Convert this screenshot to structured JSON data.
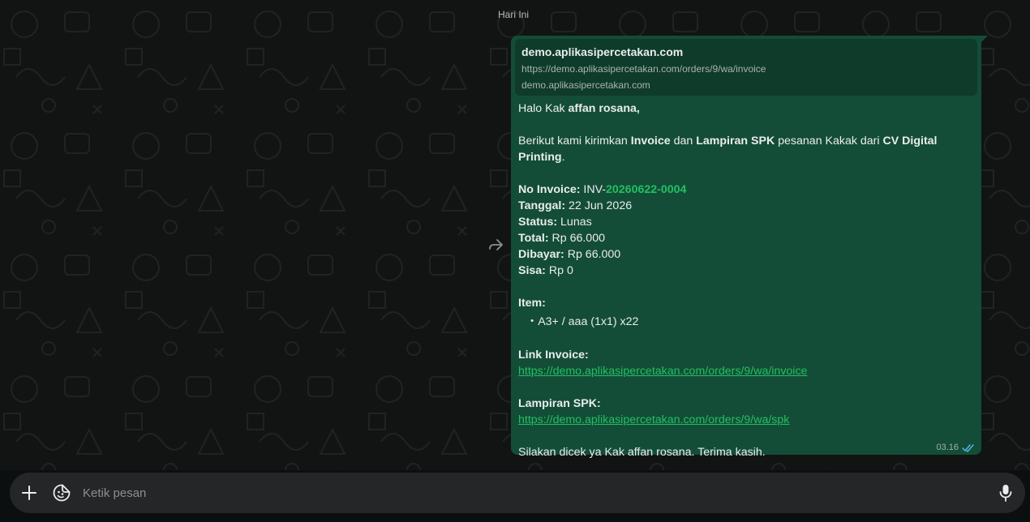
{
  "date_chip": "Hari Ini",
  "message": {
    "link_preview": {
      "title": "demo.aplikasipercetakan.com",
      "url": "https://demo.aplikasipercetakan.com/orders/9/wa/invoice",
      "domain": "demo.aplikasipercetakan.com"
    },
    "greeting_prefix": "Halo Kak ",
    "customer_name": "affan rosana",
    "greeting_suffix": ",",
    "intro": {
      "p1": "Berikut kami kirimkan ",
      "invoice": "Invoice",
      "p2": " dan ",
      "spk": "Lampiran SPK",
      "p3": " pesanan Kakak dari ",
      "company": "CV Digital Printing",
      "p4": "."
    },
    "details": {
      "no_invoice_label": "No Invoice:",
      "no_invoice_prefix": " INV-",
      "no_invoice_number": "20260622-0004",
      "tanggal_label": "Tanggal:",
      "tanggal_value": " 22 Jun 2026",
      "status_label": "Status:",
      "status_value": " Lunas",
      "total_label": "Total:",
      "total_value": " Rp 66.000",
      "dibayar_label": "Dibayar:",
      "dibayar_value": " Rp 66.000",
      "sisa_label": "Sisa:",
      "sisa_value": " Rp 0"
    },
    "item_label": "Item:",
    "item_bullet": "・",
    "items": [
      "A3+ / aaa (1x1) x22"
    ],
    "link_invoice_label": "Link Invoice:",
    "link_invoice_url": "https://demo.aplikasipercetakan.com/orders/9/wa/invoice",
    "lampiran_label": "Lampiran SPK:",
    "lampiran_url": "https://demo.aplikasipercetakan.com/orders/9/wa/spk",
    "closing": "Silakan dicek ya Kak affan rosana. Terima kasih.",
    "time": "03.16"
  },
  "composer": {
    "placeholder": "Ketik pesan"
  },
  "icons": {
    "forward": "forward-icon",
    "read_receipt": "double-check-icon",
    "attach": "plus-icon",
    "sticker": "sticker-icon",
    "mic": "microphone-icon"
  },
  "colors": {
    "bubble": "#144d37",
    "link_preview": "#0f3b2a",
    "accent": "#21c063",
    "chat_background": "#121414",
    "composer": "#242627"
  }
}
